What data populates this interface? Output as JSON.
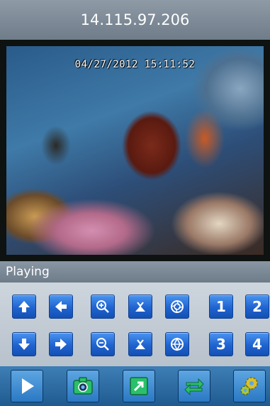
{
  "header": {
    "title": "14.115.97.206"
  },
  "video": {
    "timestamp": "04/27/2012 15:11:52"
  },
  "status": {
    "text": "Playing"
  },
  "ptz": {
    "presets": [
      "1",
      "2",
      "3",
      "4"
    ]
  },
  "colors": {
    "button_blue": "#1f63cf",
    "title_bar": "#7f8b97",
    "toolbar": "#2e6da3"
  }
}
